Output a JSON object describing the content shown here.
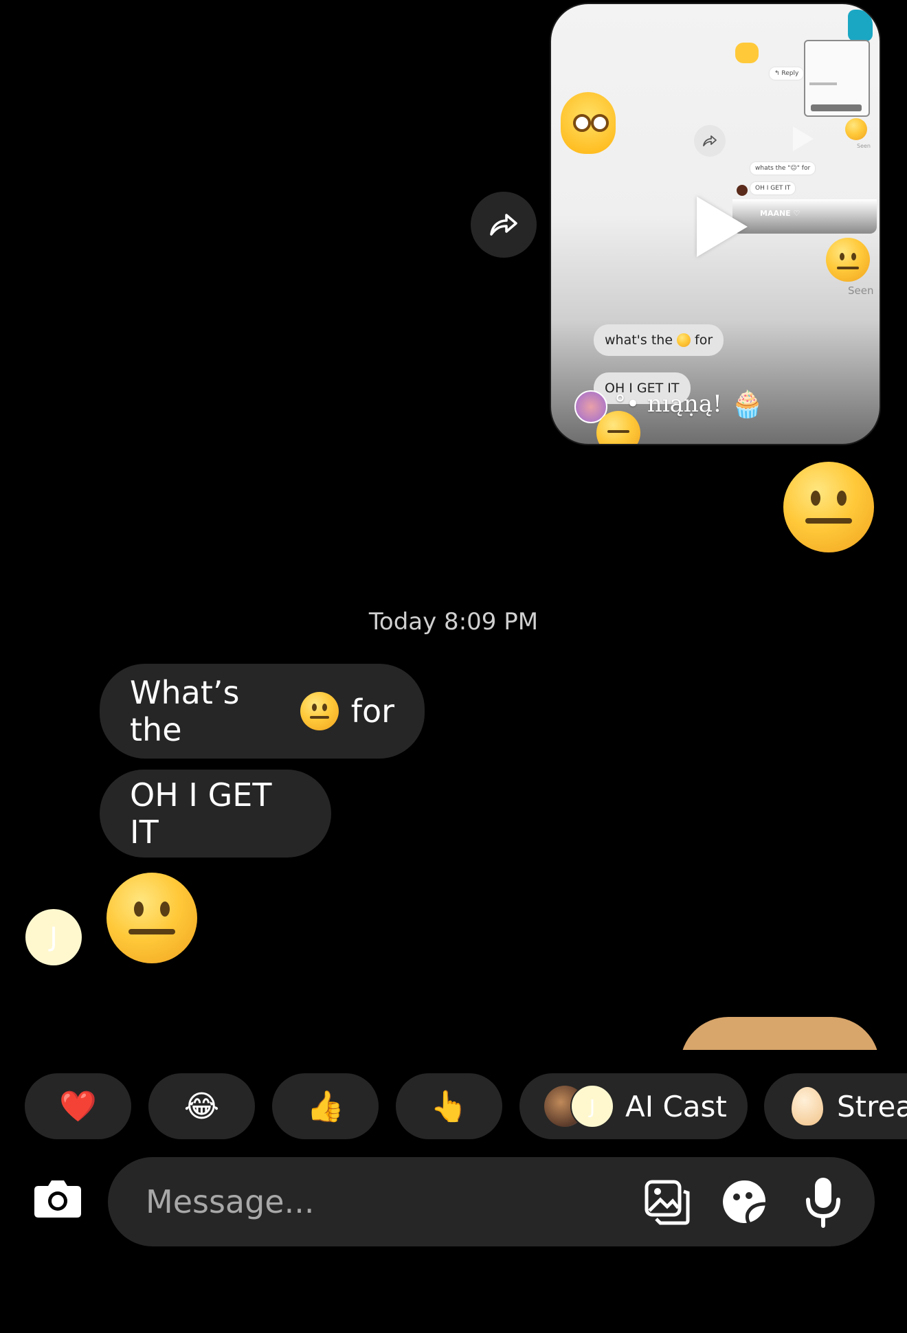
{
  "shared_video": {
    "top_reply_label": "↰ Reply",
    "tiny_msg_1": "whats the \"😐\" for",
    "tiny_msg_2": "OH I GET IT",
    "tiny_name": "MAANE ♡",
    "seen_small": "Seen",
    "seen_label": "Seen",
    "caption_msg_1_prefix": "what's the",
    "caption_msg_1_suffix": "for",
    "caption_msg_2": "OH I GET IT",
    "sender_name": "°• nıąṇą!",
    "sender_badge": "🧁"
  },
  "sent_reaction": "😐",
  "timestamp": "Today 8:09 PM",
  "messages": {
    "msg1_prefix": "What’s the",
    "msg1_suffix": "for",
    "msg2": "OH I GET IT",
    "avatar_initial": "J"
  },
  "quick_replies": {
    "heart": "❤️",
    "laugh": "😂",
    "thumbs": "👍",
    "point": "👆",
    "ai_cast_avatar_initial": "J",
    "ai_cast_label": "AI Cast",
    "stream_label": "Strea"
  },
  "composer": {
    "placeholder": "Message..."
  },
  "colors": {
    "background": "#000000",
    "bubble": "#262626",
    "accent_corner": "#1aa7c4"
  }
}
